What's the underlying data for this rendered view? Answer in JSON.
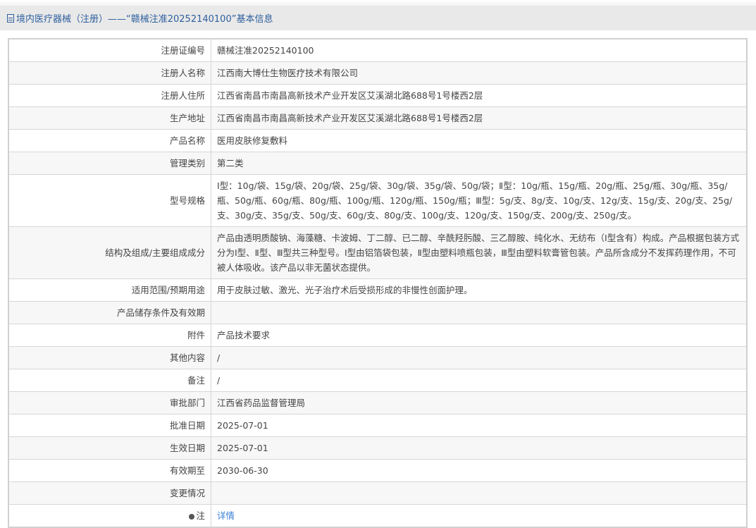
{
  "header": {
    "title": "境内医疗器械（注册）——“赣械注准20252140100”基本信息",
    "icon": "document-icon"
  },
  "rows": [
    {
      "label": "注册证编号",
      "value": "赣械注准20252140100"
    },
    {
      "label": "注册人名称",
      "value": "江西南大博仕生物医疗技术有限公司"
    },
    {
      "label": "注册人住所",
      "value": "江西省南昌市南昌高新技术产业开发区艾溪湖北路688号1号楼西2层"
    },
    {
      "label": "生产地址",
      "value": "江西省南昌市南昌高新技术产业开发区艾溪湖北路688号1号楼西2层"
    },
    {
      "label": "产品名称",
      "value": "医用皮肤修复敷料"
    },
    {
      "label": "管理类别",
      "value": "第二类"
    },
    {
      "label": "型号规格",
      "value": "Ⅰ型：10g/袋、15g/袋、20g/袋、25g/袋、30g/袋、35g/袋、50g/袋；Ⅱ型：10g/瓶、15g/瓶、20g/瓶、25g/瓶、30g/瓶、35g/瓶、50g/瓶、60g/瓶、80g/瓶、100g/瓶、120g/瓶、150g/瓶；Ⅲ型：5g/支、8g/支、10g/支、12g/支、15g/支、20g/支、25g/支、30g/支、35g/支、50g/支、60g/支、80g/支、100g/支、120g/支、150g/支、200g/支、250g/支。"
    },
    {
      "label": "结构及组成/主要组成成分",
      "value": "产品由透明质酸钠、海藻糖、卡波姆、丁二醇、已二醇、辛酰羟肟酸、三乙醇胺、纯化水、无纺布（Ⅰ型含有）构成。产品根据包装方式分为Ⅰ型、Ⅱ型、Ⅲ型共三种型号。Ⅰ型由铝箔袋包装，Ⅱ型由塑料喷瓶包装，Ⅲ型由塑料软膏管包装。产品所含成分不发挥药理作用，不可被人体吸收。该产品以非无菌状态提供。"
    },
    {
      "label": "适用范围/预期用途",
      "value": "用于皮肤过敏、激光、光子治疗术后受损形成的非慢性创面护理。"
    },
    {
      "label": "产品储存条件及有效期",
      "value": ""
    },
    {
      "label": "附件",
      "value": "产品技术要求"
    },
    {
      "label": "其他内容",
      "value": "/"
    },
    {
      "label": "备注",
      "value": "/"
    },
    {
      "label": "审批部门",
      "value": "江西省药品监督管理局"
    },
    {
      "label": "批准日期",
      "value": "2025-07-01"
    },
    {
      "label": "生效日期",
      "value": "2025-07-01"
    },
    {
      "label": "有效期至",
      "value": "2030-06-30"
    },
    {
      "label": "变更情况",
      "value": ""
    },
    {
      "label": "注",
      "value": "详情",
      "link": true,
      "icon": "dot-icon"
    }
  ]
}
